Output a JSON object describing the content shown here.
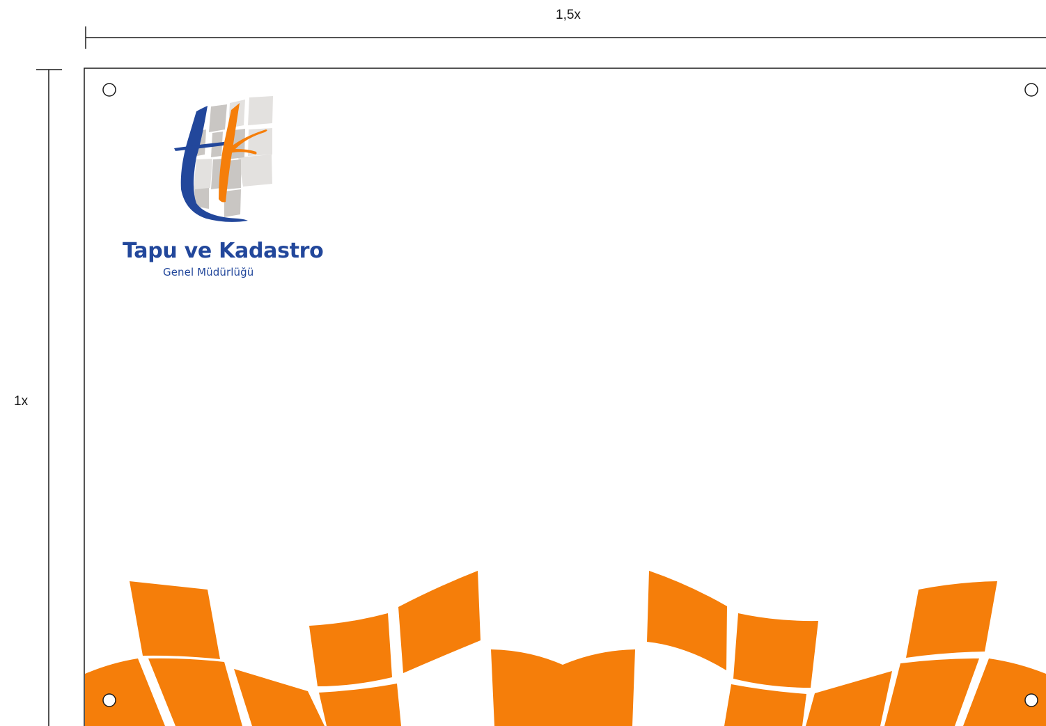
{
  "dimensions": {
    "width_label": "1,5x",
    "height_label": "1x"
  },
  "logo": {
    "title": "Tapu ve Kadastro",
    "subtitle": "Genel Müdürlüğü",
    "monogram": "tk"
  },
  "colors": {
    "brand_blue": "#22479b",
    "brand_orange": "#f57e0a",
    "tile_grey": "#c9c6c3",
    "tile_light": "#e3e1df",
    "line": "#1a1a1a"
  },
  "icons": [
    "mounting-hole-icon",
    "tk-logo-icon"
  ]
}
